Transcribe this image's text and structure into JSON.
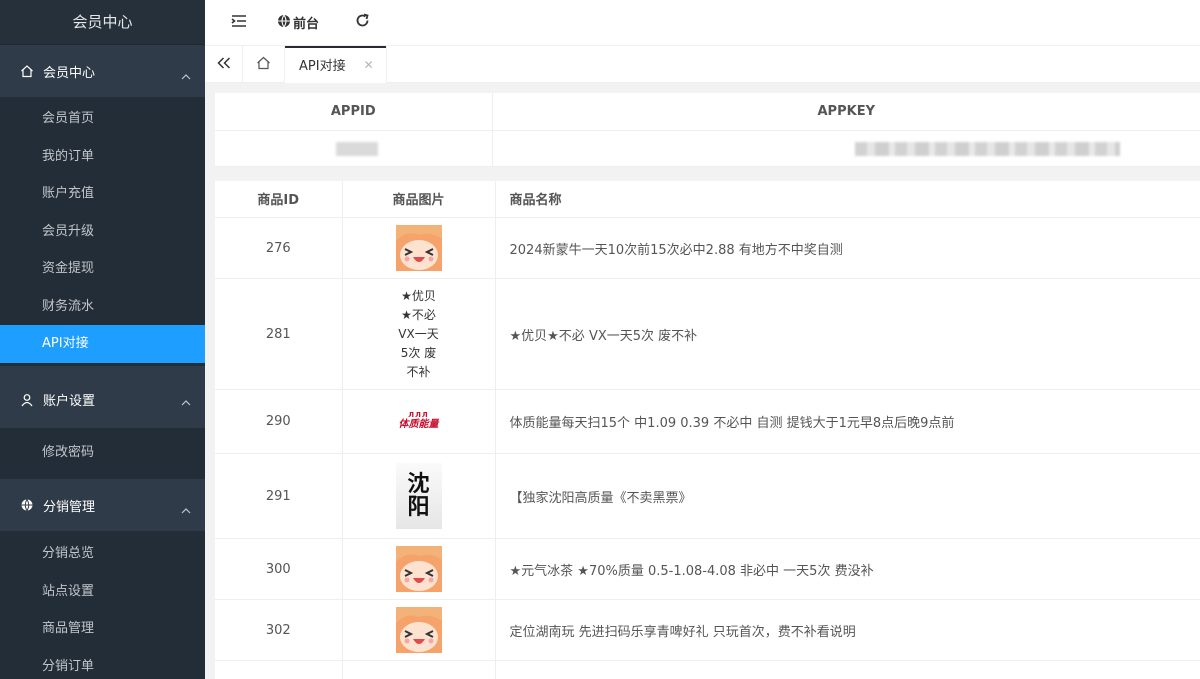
{
  "sidebar": {
    "title": "会员中心",
    "groups": [
      {
        "label": "会员中心",
        "icon": "home-icon",
        "items": [
          "会员首页",
          "我的订单",
          "账户充值",
          "会员升级",
          "资金提现",
          "财务流水",
          "API对接"
        ]
      },
      {
        "label": "账户设置",
        "icon": "user-icon",
        "items": [
          "修改密码"
        ]
      },
      {
        "label": "分销管理",
        "icon": "globe-icon",
        "items": [
          "分销总览",
          "站点设置",
          "商品管理",
          "分销订单"
        ]
      }
    ],
    "active_item": "API对接"
  },
  "header": {
    "front_label": "前台"
  },
  "tabs": {
    "active_label": "API对接"
  },
  "keys": {
    "col_appid": "APPID",
    "col_appkey": "APPKEY"
  },
  "goods": {
    "headers": [
      "商品ID",
      "商品图片",
      "商品名称"
    ],
    "rows": [
      {
        "id": "276",
        "image": "anime-face",
        "name": "2024新蒙牛一天10次前15次必中2.88 有地方不中奖自测"
      },
      {
        "id": "281",
        "image": "text",
        "image_text": [
          "★优贝",
          "★不必",
          "VX一天",
          "5次 废",
          "不补"
        ],
        "name": "★优贝★不必 VX一天5次 废不补"
      },
      {
        "id": "290",
        "image": "energy-logo",
        "logo_top": "ЛЛЛ",
        "logo_text": "体质能量",
        "name": "体质能量每天扫15个 中1.09 0.39 不必中 自测 提钱大于1元早8点后晚9点前"
      },
      {
        "id": "291",
        "image": "calligraphy",
        "calli_text": [
          "沈",
          "阳"
        ],
        "name": "【独家沈阳高质量《不卖黑票》"
      },
      {
        "id": "300",
        "image": "anime-face",
        "name": "★元气冰茶 ★70%质量 0.5-1.08-4.08 非必中 一天5次 费没补"
      },
      {
        "id": "302",
        "image": "anime-face",
        "name": "定位湖南玩 先进扫码乐享青啤好礼 只玩首次，费不补看说明"
      }
    ]
  }
}
